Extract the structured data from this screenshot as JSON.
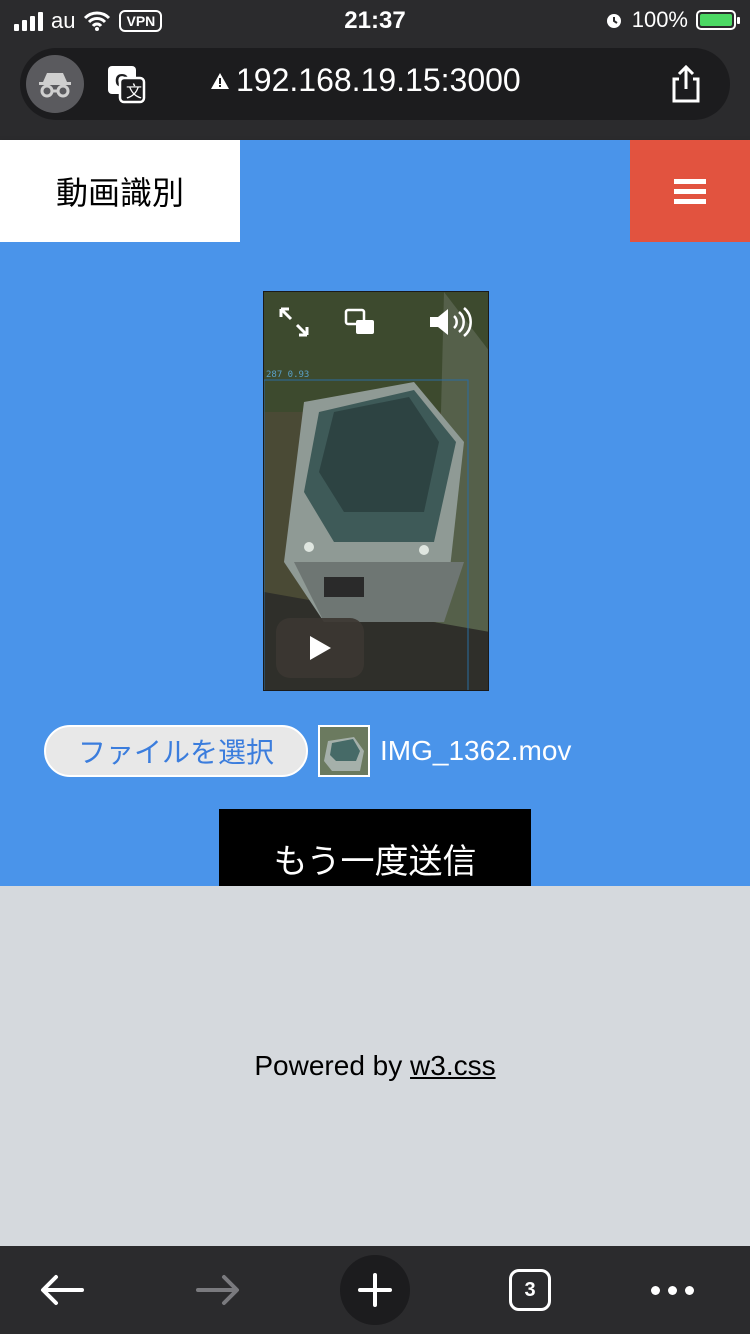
{
  "status_bar": {
    "carrier": "au",
    "vpn": "VPN",
    "time": "21:37",
    "battery": "100%"
  },
  "browser": {
    "url": "192.168.19.15:3000",
    "tab_count": "3"
  },
  "app": {
    "title": "動画識別",
    "colors": {
      "header": "#4a94ea",
      "menu": "#e2533f"
    }
  },
  "video": {
    "detection_label": "287 0.93"
  },
  "upload": {
    "choose_file_label": "ファイルを選択",
    "file_name": "IMG_1362.mov",
    "resend_label": "もう一度送信"
  },
  "footer": {
    "powered_by": "Powered by",
    "link_text": "w3.css"
  }
}
